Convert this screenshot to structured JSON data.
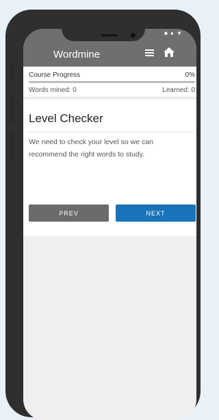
{
  "app": {
    "title": "Wordmine",
    "status_icons": "■ ● ▼"
  },
  "progress": {
    "label": "Course Progress",
    "percent_text": "0%",
    "percent_value": 0,
    "words_mined": "Words mined: 0",
    "learned": "Learned: 0"
  },
  "card": {
    "title": "Level Checker",
    "text": "We need to check your level so we can recommend the right words to study."
  },
  "buttons": {
    "prev": "PREV",
    "next": "NEXT"
  },
  "colors": {
    "accent": "#1a73b8",
    "appbar": "#6f6f6f",
    "phone": "#2f2f2f"
  },
  "icons": {
    "menu": "menu-icon",
    "home": "home-icon"
  }
}
